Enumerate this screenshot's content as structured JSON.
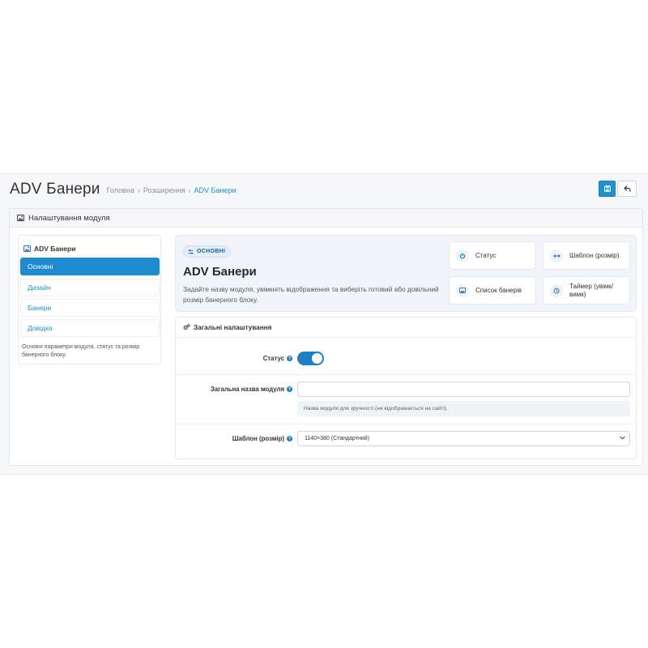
{
  "page": {
    "title": "ADV Банери",
    "breadcrumb": [
      "Головна",
      "Розширення",
      "ADV Банери"
    ]
  },
  "card": {
    "header": "Налаштування модуля"
  },
  "nav": {
    "title": "ADV Банери",
    "items": [
      {
        "label": "Основні",
        "active": true
      },
      {
        "label": "Дизайн",
        "active": false
      },
      {
        "label": "Банери",
        "active": false
      },
      {
        "label": "Довідка",
        "active": false
      }
    ],
    "description": "Основні параметри модуля, статус та розмір банерного блоку."
  },
  "hero": {
    "badge": "ОСНОВНІ",
    "title": "ADV Банери",
    "description": "Задайте назву модуля, увімкніть відображення та виберіть готовий або довільний розмір банерного блоку.",
    "tiles": [
      {
        "label": "Статус",
        "icon": "power-icon"
      },
      {
        "label": "Шаблон (розмір)",
        "icon": "resize-icon"
      },
      {
        "label": "Список банерів",
        "icon": "image-icon"
      },
      {
        "label": "Таймер (увімк/вимк)",
        "icon": "clock-icon"
      }
    ]
  },
  "settings": {
    "title": "Загальні налаштування",
    "status_label": "Статус",
    "status_on": true,
    "name_label": "Загальна назва модуля",
    "name_value": "",
    "name_hint": "Назва модуля для зручності (не відображається на сайті).",
    "template_label": "Шаблон (розмір)",
    "template_value": "1140×380 (Стандартний)"
  },
  "colors": {
    "primary": "#1e91cf",
    "active_nav": "#1e8bd0",
    "toggle": "#1e7fc2"
  }
}
